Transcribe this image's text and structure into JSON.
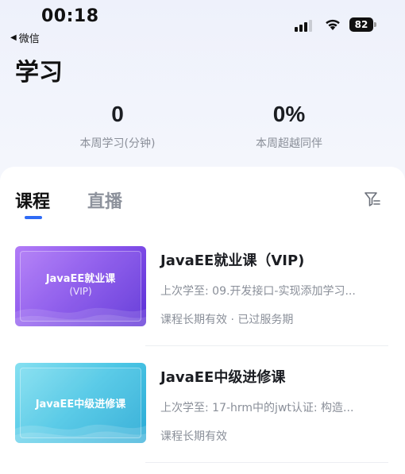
{
  "status_bar": {
    "time": "00:18",
    "back_app": "微信",
    "battery": "82"
  },
  "page": {
    "title": "学习"
  },
  "stats": [
    {
      "value": "0",
      "caption": "本周学习(分钟)"
    },
    {
      "value": "0%",
      "caption": "本周超越同伴"
    }
  ],
  "tabs": [
    {
      "label": "课程",
      "active": true
    },
    {
      "label": "直播",
      "active": false
    }
  ],
  "courses": [
    {
      "thumb_line1": "JavaEE就业课",
      "thumb_line2": "(VIP)",
      "thumb_color": "#8a55ec",
      "title": "JavaEE就业课（VIP)",
      "last_study": "上次学至:  09.开发接口-实现添加学习...",
      "status": "课程长期有效 · 已过服务期"
    },
    {
      "thumb_line1": "JavaEE中级进修课",
      "thumb_line2": "",
      "thumb_color": "#4cc6e5",
      "title": "JavaEE中级进修课",
      "last_study": "上次学至:  17-hrm中的jwt认证:  构造...",
      "status": "课程长期有效"
    }
  ],
  "colors": {
    "accent": "#2f6bf5",
    "text_primary": "#1b1d22",
    "text_secondary": "#8a8f99"
  }
}
